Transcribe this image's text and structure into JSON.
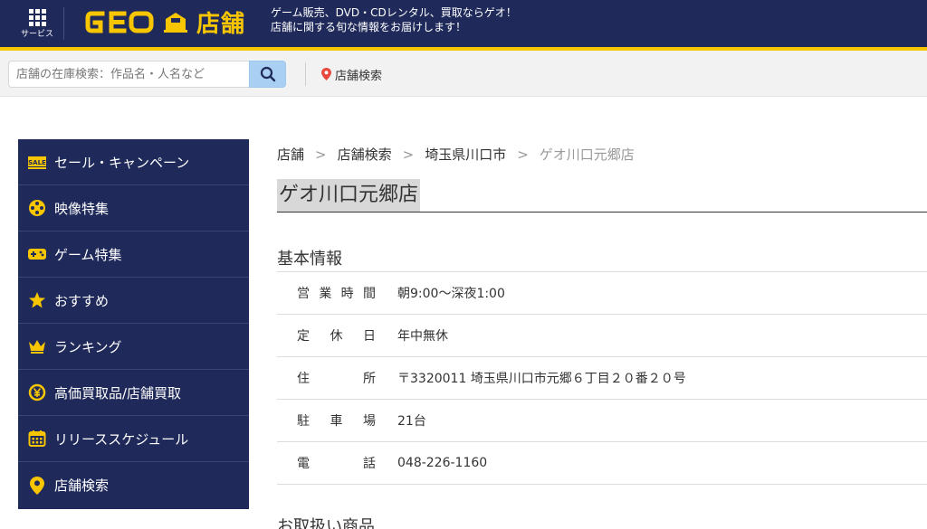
{
  "header": {
    "service_label": "サービス",
    "shop_label": "店舗",
    "tagline_1": "ゲーム販売、DVD・CDレンタル、買取ならゲオ！",
    "tagline_2": "店舗に関する旬な情報をお届けします！",
    "colors": {
      "navy": "#1f2a5a",
      "yellow": "#f7c600"
    }
  },
  "search": {
    "placeholder": "店舗の在庫検索：作品名・人名など",
    "store_search_label": "店舗検索"
  },
  "sidebar": {
    "items": [
      {
        "label": "セール・キャンペーン",
        "icon": "sale-icon"
      },
      {
        "label": "映像特集",
        "icon": "film-reel-icon"
      },
      {
        "label": "ゲーム特集",
        "icon": "game-controller-icon"
      },
      {
        "label": "おすすめ",
        "icon": "star-icon"
      },
      {
        "label": "ランキング",
        "icon": "crown-icon"
      },
      {
        "label": "高価買取品/店舗買取",
        "icon": "yen-exchange-icon"
      },
      {
        "label": "リリーススケジュール",
        "icon": "calendar-icon"
      },
      {
        "label": "店舗検索",
        "icon": "map-pin-icon"
      }
    ]
  },
  "breadcrumb": {
    "items": [
      "店舗",
      "店舗検索",
      "埼玉県川口市"
    ],
    "current": "ゲオ川口元郷店"
  },
  "page_title": "ゲオ川口元郷店",
  "basic_info": {
    "heading": "基本情報",
    "rows": [
      {
        "label": [
          "営",
          "業",
          "時",
          "間"
        ],
        "value": "朝9:00〜深夜1:00"
      },
      {
        "label": [
          "定",
          "休",
          "日"
        ],
        "value": "年中無休"
      },
      {
        "label": [
          "住",
          "所"
        ],
        "value": "〒3320011 埼玉県川口市元郷６丁目２０番２０号"
      },
      {
        "label": [
          "駐",
          "車",
          "場"
        ],
        "value": "21台"
      },
      {
        "label": [
          "電",
          "話"
        ],
        "value": "048-226-1160"
      }
    ]
  },
  "products_heading": "お取扱い商品"
}
